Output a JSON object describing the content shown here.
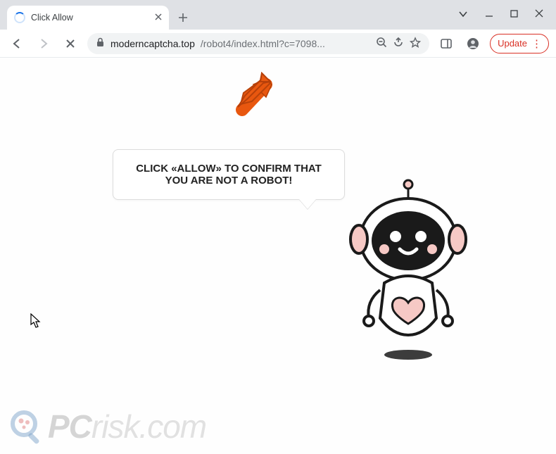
{
  "tab": {
    "title": "Click Allow"
  },
  "url": {
    "domain": "moderncaptcha.top",
    "path": "/robot4/index.html?c=7098..."
  },
  "update_btn": {
    "label": "Update"
  },
  "page": {
    "message": "CLICK «ALLOW» TO CONFIRM THAT YOU ARE NOT A ROBOT!"
  },
  "watermark": {
    "pc": "PC",
    "rest": "risk.com"
  }
}
